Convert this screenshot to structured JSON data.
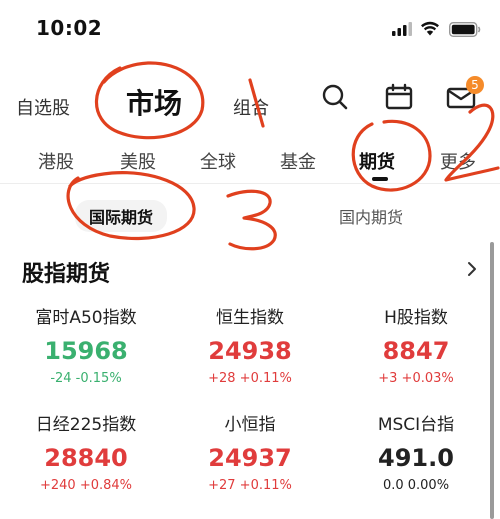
{
  "status_bar": {
    "time": "10:02"
  },
  "top_nav": {
    "tabs": [
      {
        "label": "自选股"
      },
      {
        "label": "市场"
      },
      {
        "label": "组合"
      }
    ],
    "mail_badge": "5"
  },
  "market_tabs": [
    {
      "label": "港股"
    },
    {
      "label": "美股"
    },
    {
      "label": "全球"
    },
    {
      "label": "基金"
    },
    {
      "label": "期货"
    },
    {
      "label": "更多"
    }
  ],
  "sub_tabs": [
    {
      "label": "国际期货"
    },
    {
      "label": "国内期货"
    }
  ],
  "section": {
    "title": "股指期货"
  },
  "indices": [
    {
      "name": "富时A50指数",
      "price": "15968",
      "change": "-24 -0.15%"
    },
    {
      "name": "恒生指数",
      "price": "24938",
      "change": "+28 +0.11%"
    },
    {
      "name": "H股指数",
      "price": "8847",
      "change": "+3 +0.03%"
    },
    {
      "name": "日经225指数",
      "price": "28840",
      "change": "+240 +0.84%"
    },
    {
      "name": "小恒指",
      "price": "24937",
      "change": "+27 +0.11%"
    },
    {
      "name": "MSCI台指",
      "price": "491.0",
      "change": "0.0 0.00%"
    }
  ],
  "annotations": [
    "1",
    "2",
    "3"
  ],
  "colors": {
    "up": "#e03c3c",
    "down": "#3ab06f",
    "annotation": "#e0401e",
    "badge": "#f58b2a"
  }
}
